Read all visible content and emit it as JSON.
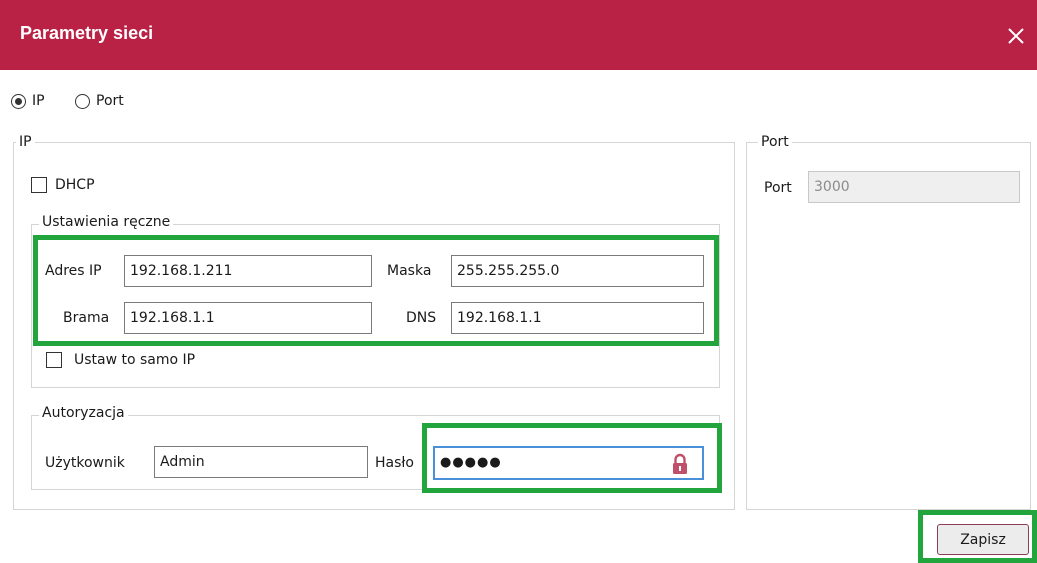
{
  "window": {
    "title": "Parametry sieci",
    "title_bar_color": "#ba2245",
    "close_icon": "close-icon"
  },
  "mode": {
    "options": [
      {
        "label": "IP",
        "selected": true
      },
      {
        "label": "Port",
        "selected": false
      }
    ]
  },
  "ip_group": {
    "legend": "IP",
    "dhcp": {
      "label": "DHCP",
      "checked": false
    },
    "manual": {
      "legend": "Ustawienia ręczne",
      "ip_label": "Adres IP",
      "ip_value": "192.168.1.211",
      "mask_label": "Maska",
      "mask_value": "255.255.255.0",
      "gateway_label": "Brama",
      "gateway_value": "192.168.1.1",
      "dns_label": "DNS",
      "dns_value": "192.168.1.1",
      "same_ip": {
        "label": "Ustaw to samo IP",
        "checked": false
      }
    },
    "auth": {
      "legend": "Autoryzacja",
      "user_label": "Użytkownik",
      "user_value": "Admin",
      "password_label": "Hasło",
      "password_value": "●●●●●",
      "password_icon": "lock-icon"
    }
  },
  "port_group": {
    "legend": "Port",
    "port_label": "Port",
    "port_value": "3000"
  },
  "save_button": "Zapisz",
  "highlight_color": "#22a53d"
}
